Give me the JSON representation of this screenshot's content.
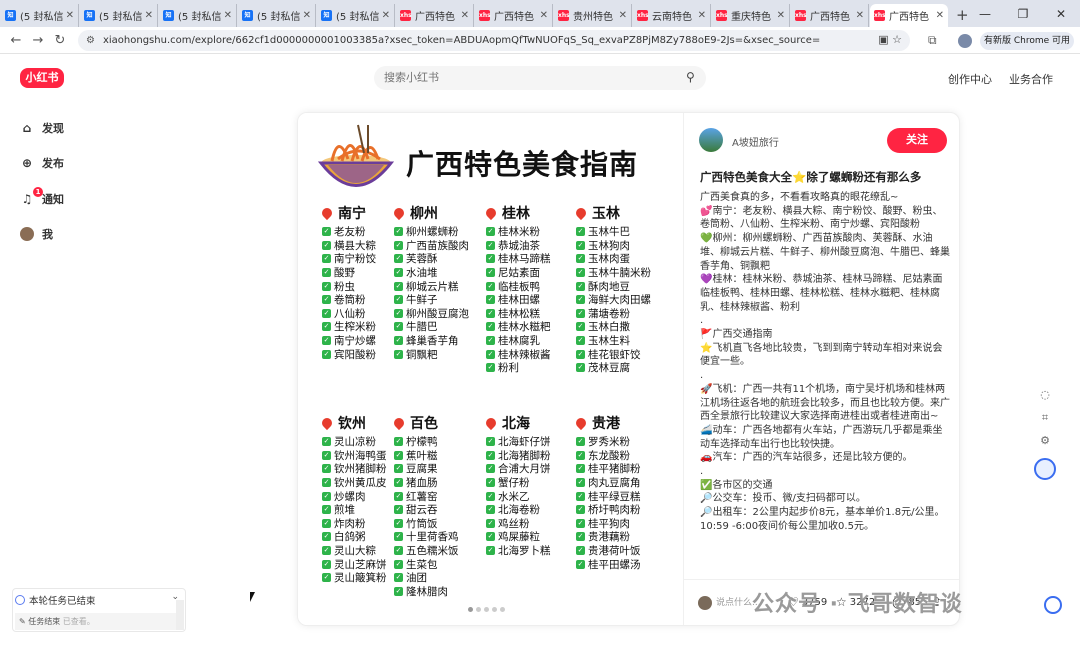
{
  "tabs": [
    {
      "fav": "知",
      "kind": "zh",
      "title": "(5 封私信"
    },
    {
      "fav": "知",
      "kind": "zh",
      "title": "(5 封私信"
    },
    {
      "fav": "知",
      "kind": "zh",
      "title": "(5 封私信"
    },
    {
      "fav": "知",
      "kind": "zh",
      "title": "(5 封私信"
    },
    {
      "fav": "知",
      "kind": "zh",
      "title": "(5 封私信"
    },
    {
      "fav": "xhs",
      "kind": "xhs",
      "title": "广西特色"
    },
    {
      "fav": "xhs",
      "kind": "xhs",
      "title": "广西特色"
    },
    {
      "fav": "xhs",
      "kind": "xhs",
      "title": "贵州特色"
    },
    {
      "fav": "xhs",
      "kind": "xhs",
      "title": "云南特色"
    },
    {
      "fav": "xhs",
      "kind": "xhs",
      "title": "重庆特色"
    },
    {
      "fav": "xhs",
      "kind": "xhs",
      "title": "广西特色"
    },
    {
      "fav": "xhs",
      "kind": "xhs",
      "title": "广西特色"
    }
  ],
  "browser": {
    "url": "xiaohongshu.com/explore/662cf1d0000000001003385a?xsec_token=ABDUAopmQfTwNUOFqS_Sq_exvaPZ8PjM8Zy788oE9-2Js=&xsec_source=",
    "update_label": "有新版 Chrome 可用"
  },
  "site": {
    "logo": "小红书",
    "search_placeholder": "搜索小红书",
    "nav_creator": "创作中心",
    "nav_business": "业务合作"
  },
  "sidebar": [
    {
      "icon": "⌂",
      "label": "发现",
      "name": "sidebar-item-discover"
    },
    {
      "icon": "⊕",
      "label": "发布",
      "name": "sidebar-item-publish"
    },
    {
      "icon": "♫",
      "label": "通知",
      "name": "sidebar-item-notify",
      "badge": "1"
    },
    {
      "icon": "",
      "label": "我",
      "name": "sidebar-item-me"
    }
  ],
  "image": {
    "title": "广西特色美食指南",
    "regions_row1": [
      {
        "name": "南宁",
        "items": [
          "老友粉",
          "横县大粽",
          "南宁粉饺",
          "酸野",
          "粉虫",
          "卷筒粉",
          "八仙粉",
          "生榨米粉",
          "南宁炒螺",
          "宾阳酸粉"
        ]
      },
      {
        "name": "柳州",
        "items": [
          "柳州螺蛳粉",
          "广西苗族酸肉",
          "芙蓉酥",
          "水油堆",
          "柳城云片糕",
          "牛鲜子",
          "柳州酸豆腐泡",
          "牛腊巴",
          "蜂巢香芋角",
          "铜飘粑"
        ]
      },
      {
        "name": "桂林",
        "items": [
          "桂林米粉",
          "恭城油茶",
          "桂林马蹄糕",
          "尼姑素面",
          "临桂板鸭",
          "桂林田螺",
          "桂林松糕",
          "桂林水糍粑",
          "桂林腐乳",
          "桂林辣椒酱",
          "粉利"
        ]
      },
      {
        "name": "玉林",
        "items": [
          "玉林牛巴",
          "玉林狗肉",
          "玉林肉蛋",
          "玉林牛腩米粉",
          "酥肉地豆",
          "海鲜大肉田螺",
          "蒲塘卷粉",
          "玉林白撒",
          "玉林生料",
          "桂花银虾饺",
          "茂林豆腐"
        ]
      }
    ],
    "regions_row2": [
      {
        "name": "钦州",
        "items": [
          "灵山凉粉",
          "钦州海鸭蛋",
          "钦州猪脚粉",
          "钦州黄瓜皮",
          "炒螺肉",
          "煎堆",
          "炸肉粉",
          "白鸽粥",
          "灵山大粽",
          "灵山芝麻饼",
          "灵山簸箕粉"
        ]
      },
      {
        "name": "百色",
        "items": [
          "柠檬鸭",
          "蕉叶糍",
          "豆腐果",
          "猪血肠",
          "红薯窑",
          "甜云吞",
          "竹筒饭",
          "十里荷香鸡",
          "五色糯米饭",
          "生菜包",
          "油团",
          "隆林腊肉"
        ]
      },
      {
        "name": "北海",
        "items": [
          "北海虾仔饼",
          "北海猪脚粉",
          "合浦大月饼",
          "蟹仔粉",
          "水米乙",
          "北海卷粉",
          "鸡丝粉",
          "鸡屎藤粒",
          "北海罗卜糕"
        ]
      },
      {
        "name": "贵港",
        "items": [
          "罗秀米粉",
          "东龙酸粉",
          "桂平猪脚粉",
          "肉丸豆腐角",
          "桂平绿豆糕",
          "桥圩鸭肉粉",
          "桂平狗肉",
          "贵港藕粉",
          "贵港荷叶饭",
          "桂平田螺汤"
        ]
      }
    ]
  },
  "note": {
    "author": "A坡妞旅行",
    "follow_label": "关注",
    "title": "广西特色美食大全⭐除了螺蛳粉还有那么多",
    "paragraphs": [
      "广西美食真的多，不看看攻略真的眼花缭乱~",
      "💕南宁：老友粉、横县大粽、南宁粉饺、酸野、粉虫、卷筒粉、八仙粉、生榨米粉、南宁炒螺、宾阳酸粉",
      "💚柳州：柳州螺蛳粉、广西苗族酸肉、芙蓉酥、水油堆、柳城云片糕、牛鲜子、柳州酸豆腐泡、牛腊巴、蜂巢香芋角、铜飘粑",
      "💜桂林：桂林米粉、恭城油茶、桂林马蹄糕、尼姑素面临桂板鸭、桂林田螺、桂林松糕、桂林水糍粑、桂林腐乳、桂林辣椒酱、粉利",
      ".",
      "🚩广西交通指南",
      "⭐飞机直飞各地比较贵，飞到到南宁转动车相对来说会便宜一些。",
      ".",
      "🚀飞机：广西一共有11个机场，南宁吴圩机场和桂林两江机场往返各地的航班会比较多，而且也比较方便。来广西全景旅行比较建议大家选择南进桂出或者桂进南出~",
      "🚄动车：广西各地都有火车站，广西游玩几乎都是乘坐动车选择动车出行也比较快捷。",
      "🚗汽车：广西的汽车站很多，还是比较方便的。",
      ".",
      "✅各市区的交通",
      "🔎公交车：投币、微/支扫码都可以。",
      "🔎出租车：2公里内起步价8元，基本单价1.8元/公里。10:59 -6:00夜间价每公里加收0.5元。"
    ],
    "comment_placeholder": "说点什么...",
    "likes": "3759",
    "stars": "3272",
    "comments": "85"
  },
  "task": {
    "header": "本轮任务已结束",
    "row_label": "任务结束",
    "row_status": "已查看。"
  },
  "watermark": "公众号 · 飞哥数智谈"
}
